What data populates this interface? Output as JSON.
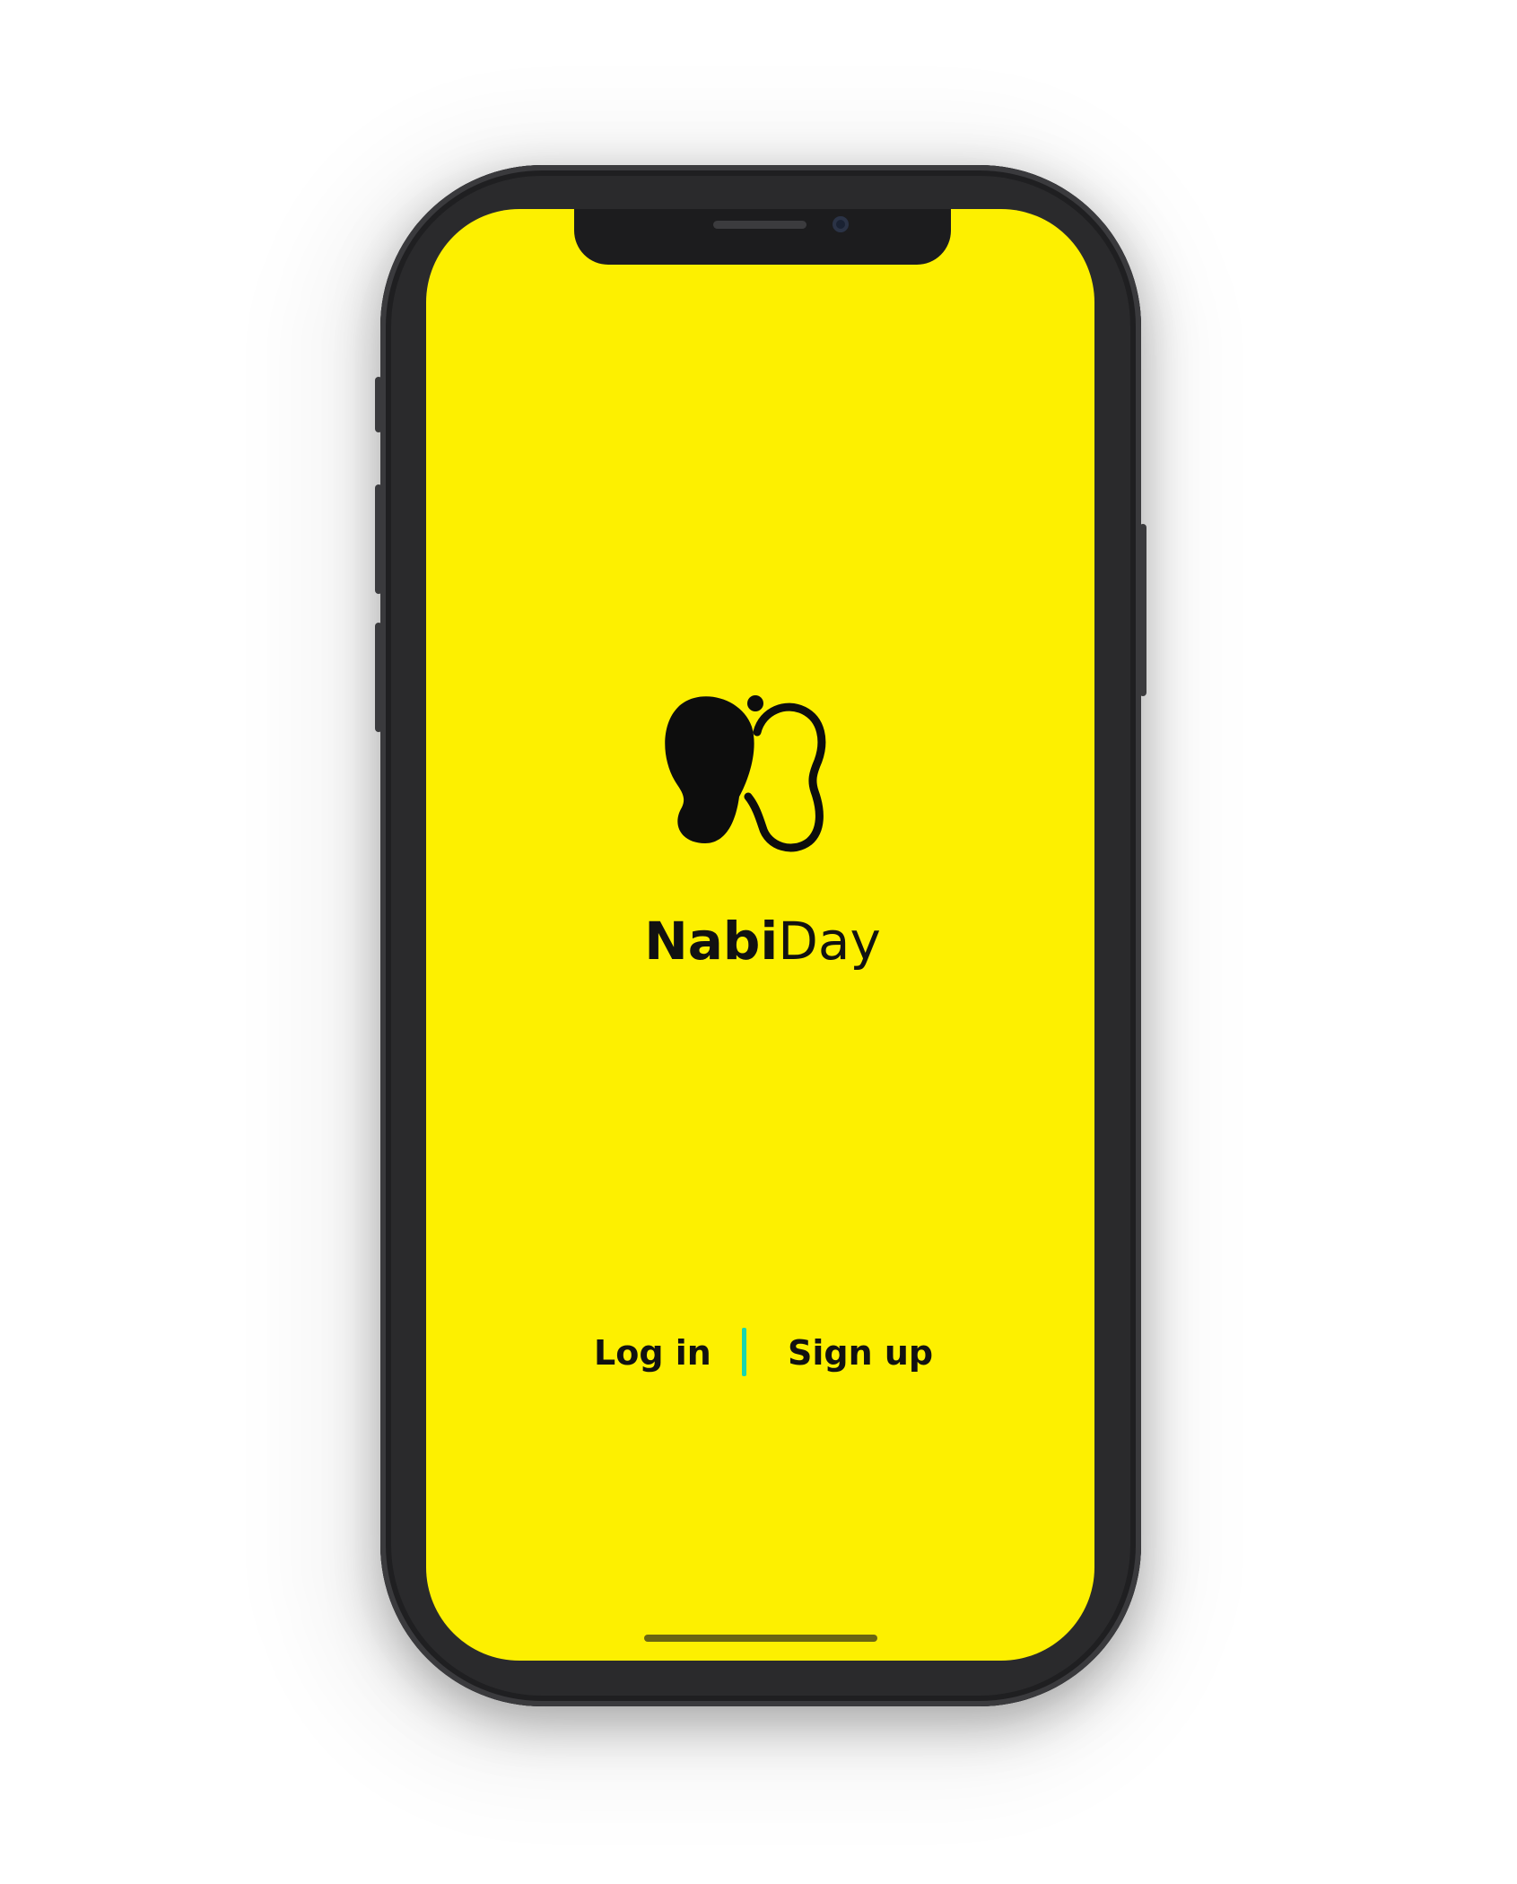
{
  "app": {
    "brand_bold": "Nabi",
    "brand_light": "Day"
  },
  "actions": {
    "login_label": "Log in",
    "signup_label": "Sign up"
  },
  "colors": {
    "screen_background": "#fdf000",
    "divider_accent": "#18d6b0",
    "text": "#111111",
    "device_frame": "#2a2a2c"
  },
  "icons": {
    "logo": "butterfly-logo-icon"
  }
}
